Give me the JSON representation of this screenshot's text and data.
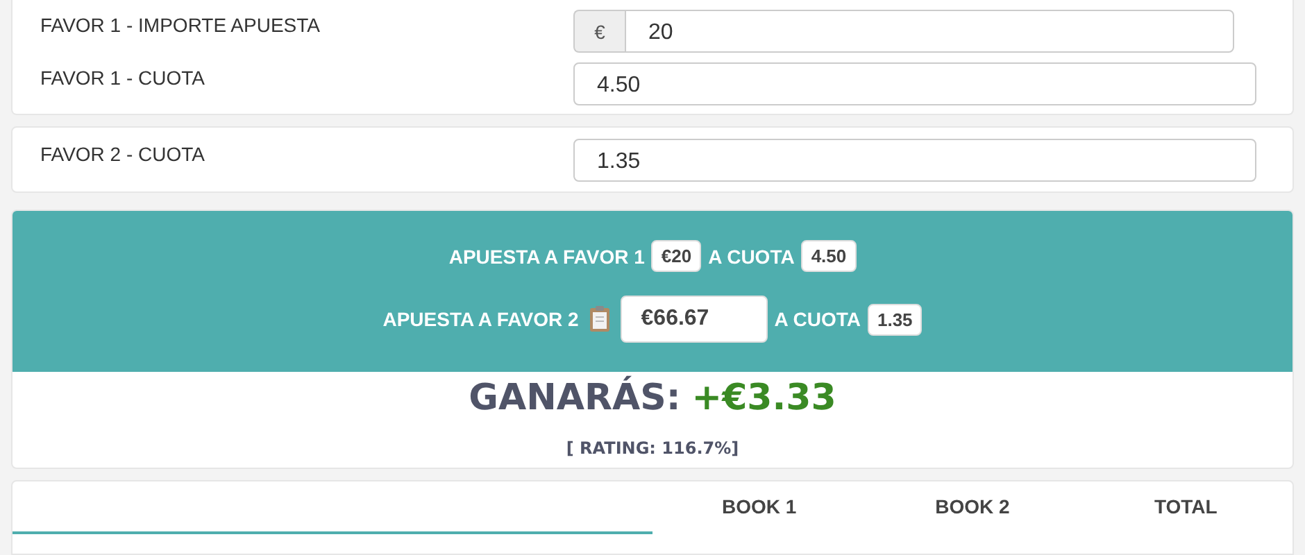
{
  "form_groups": [
    {
      "fields": [
        {
          "label": "FAVOR 1 - IMPORTE APUESTA",
          "prefix": "€",
          "value": "20"
        },
        {
          "label": "FAVOR 1 - CUOTA",
          "value": "4.50"
        }
      ]
    },
    {
      "fields": [
        {
          "label": "FAVOR 2 - CUOTA",
          "value": "1.35"
        }
      ]
    }
  ],
  "summary": {
    "lines": [
      {
        "kind": "badge",
        "label": "APUESTA A FAVOR 1",
        "stake": "€20",
        "odds_label": "A CUOTA",
        "odds": "4.50"
      },
      {
        "kind": "copyable",
        "label": "APUESTA A FAVOR 2",
        "stake": "€66.67",
        "odds_label": "A CUOTA",
        "odds": "1.35"
      }
    ]
  },
  "result": {
    "label": "GANARÁS:",
    "profit": "+€3.33",
    "rating": "[ RATING: 116.7%]"
  },
  "table": {
    "columns": [
      "BOOK 1",
      "BOOK 2",
      "TOTAL"
    ]
  }
}
